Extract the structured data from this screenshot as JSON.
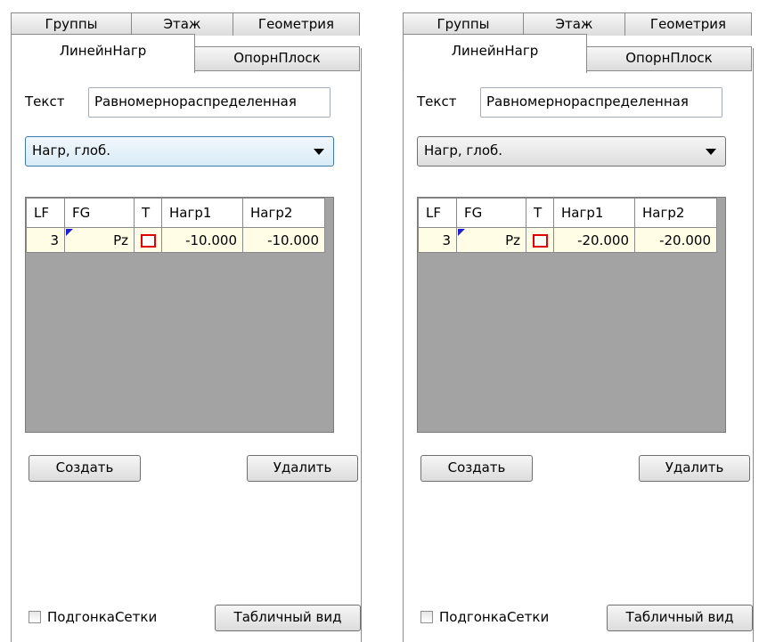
{
  "panels": [
    {
      "tabs": {
        "groups": "Группы",
        "floor": "Этаж",
        "geometry": "Геометрия",
        "linear_load": "ЛинейнНагр",
        "support_plane": "ОпорнПлоск"
      },
      "text_label": "Текст",
      "text_value": "Равномернораспределенная",
      "combo_value": "Нагр, глоб.",
      "table": {
        "headers": [
          "LF",
          "FG",
          "T",
          "Нагр1",
          "Нагр2"
        ],
        "row": {
          "lf": "3",
          "fg": "Pz",
          "load1": "-10.000",
          "load2": "-10.000"
        }
      },
      "buttons": {
        "create": "Создать",
        "delete": "Удалить",
        "table_view": "Табличный вид"
      },
      "checkbox_label": "ПодгонкаСетки",
      "checkbox_checked": false
    },
    {
      "tabs": {
        "groups": "Группы",
        "floor": "Этаж",
        "geometry": "Геометрия",
        "linear_load": "ЛинейнНагр",
        "support_plane": "ОпорнПлоск"
      },
      "text_label": "Текст",
      "text_value": "Равномернораспределенная",
      "combo_value": "Нагр, глоб.",
      "table": {
        "headers": [
          "LF",
          "FG",
          "T",
          "Нагр1",
          "Нагр2"
        ],
        "row": {
          "lf": "3",
          "fg": "Pz",
          "load1": "-20.000",
          "load2": "-20.000"
        }
      },
      "buttons": {
        "create": "Создать",
        "delete": "Удалить",
        "table_view": "Табличный вид"
      },
      "checkbox_label": "ПодгонкаСетки",
      "checkbox_checked": false
    }
  ],
  "colors": {
    "accent_combo_border": "#3d7bad",
    "grid_background": "#a3a3a3",
    "row_background": "#fffde6",
    "t_marker": "#e00000",
    "fg_marker": "#2020d0"
  }
}
